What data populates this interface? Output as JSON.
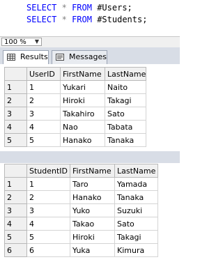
{
  "editor": {
    "line1": {
      "kw1": "SELECT",
      "op": "*",
      "kw2": "FROM",
      "table": "#Users;"
    },
    "line2": {
      "kw1": "SELECT",
      "op": "*",
      "kw2": "FROM",
      "table": "#Students;"
    }
  },
  "zoom": {
    "value": "100 %"
  },
  "tabs": {
    "results": "Results",
    "messages": "Messages"
  },
  "grid1": {
    "headers": [
      "",
      "UserID",
      "FirstName",
      "LastName"
    ],
    "rows": [
      [
        "1",
        "1",
        "Yukari",
        "Naito"
      ],
      [
        "2",
        "2",
        "Hiroki",
        "Takagi"
      ],
      [
        "3",
        "3",
        "Takahiro",
        "Sato"
      ],
      [
        "4",
        "4",
        "Nao",
        "Tabata"
      ],
      [
        "5",
        "5",
        "Hanako",
        "Tanaka"
      ]
    ]
  },
  "grid2": {
    "headers": [
      "",
      "StudentID",
      "FirstName",
      "LastName"
    ],
    "rows": [
      [
        "1",
        "1",
        "Taro",
        "Yamada"
      ],
      [
        "2",
        "2",
        "Hanako",
        "Tanaka"
      ],
      [
        "3",
        "3",
        "Yuko",
        "Suzuki"
      ],
      [
        "4",
        "4",
        "Takao",
        "Sato"
      ],
      [
        "5",
        "5",
        "Hiroki",
        "Takagi"
      ],
      [
        "6",
        "6",
        "Yuka",
        "Kimura"
      ]
    ]
  }
}
